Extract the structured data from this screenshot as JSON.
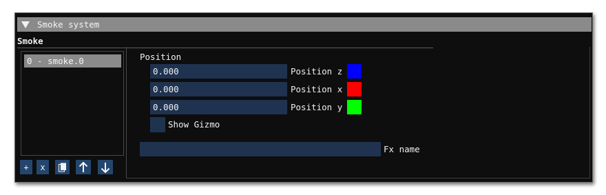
{
  "window": {
    "title": "Smoke system",
    "section_label": "Smoke"
  },
  "list": {
    "items": [
      {
        "label": "0 - smoke.0"
      }
    ]
  },
  "buttons": {
    "add_label": "+",
    "remove_label": "x"
  },
  "position": {
    "label": "Position",
    "fields": [
      {
        "value": "0.000",
        "label": "Position z",
        "color": "#0000ff"
      },
      {
        "value": "0.000",
        "label": "Position x",
        "color": "#ff0000"
      },
      {
        "value": "0.000",
        "label": "Position y",
        "color": "#00ff00"
      }
    ]
  },
  "gizmo": {
    "label": "Show Gizmo",
    "checked": false
  },
  "fx": {
    "label": "Fx name",
    "value": ""
  },
  "icons": [
    "collapse-triangle-icon",
    "copy-icon",
    "arrow-up-icon",
    "arrow-down-icon"
  ]
}
